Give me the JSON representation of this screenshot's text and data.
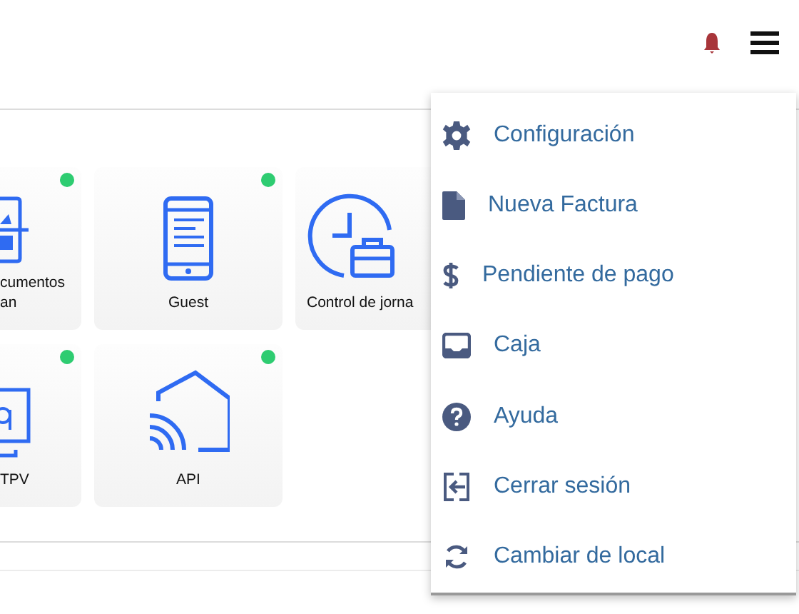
{
  "tiles": [
    {
      "label": "cumentos an",
      "online": true
    },
    {
      "label": "Guest",
      "online": true
    },
    {
      "label": "Control de jorna"
    },
    {
      "label": "TPV",
      "online": true
    },
    {
      "label": "API",
      "online": true
    }
  ],
  "menu": [
    {
      "label": "Configuración"
    },
    {
      "label": "Nueva Factura"
    },
    {
      "label": "Pendiente de pago"
    },
    {
      "label": "Caja"
    },
    {
      "label": "Ayuda"
    },
    {
      "label": "Cerrar sesión"
    },
    {
      "label": "Cambiar de local"
    }
  ]
}
